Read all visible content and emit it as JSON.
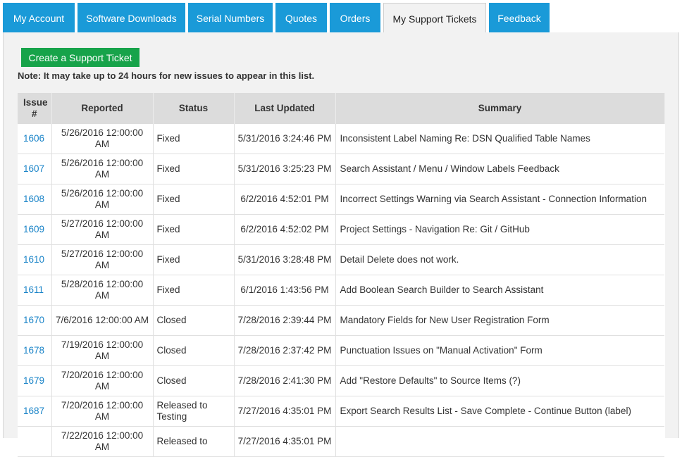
{
  "tabs": [
    {
      "label": "My Account",
      "width": 102,
      "active": false
    },
    {
      "label": "Software Downloads",
      "width": 153,
      "active": false
    },
    {
      "label": "Serial Numbers",
      "width": 120,
      "active": false
    },
    {
      "label": "Quotes",
      "width": 73,
      "active": false
    },
    {
      "label": "Orders",
      "width": 72,
      "active": false
    },
    {
      "label": "My Support Tickets",
      "width": 146,
      "active": true
    },
    {
      "label": "Feedback",
      "width": 86,
      "active": false
    }
  ],
  "create_button": "Create a Support Ticket",
  "note": "Note: It may take up to 24 hours for new issues to appear in this list.",
  "table": {
    "headers": {
      "issue": "Issue #",
      "reported": "Reported",
      "status": "Status",
      "updated": "Last Updated",
      "summary": "Summary"
    },
    "rows": [
      {
        "issue": "1606",
        "reported": "5/26/2016 12:00:00 AM",
        "status": "Fixed",
        "updated": "5/31/2016 3:24:46 PM",
        "summary": "Inconsistent Label Naming Re: DSN Qualified Table Names"
      },
      {
        "issue": "1607",
        "reported": "5/26/2016 12:00:00 AM",
        "status": "Fixed",
        "updated": "5/31/2016 3:25:23 PM",
        "summary": "Search Assistant / Menu / Window Labels Feedback"
      },
      {
        "issue": "1608",
        "reported": "5/26/2016 12:00:00 AM",
        "status": "Fixed",
        "updated": "6/2/2016 4:52:01 PM",
        "summary": "Incorrect Settings Warning via Search Assistant - Connection Information"
      },
      {
        "issue": "1609",
        "reported": "5/27/2016 12:00:00 AM",
        "status": "Fixed",
        "updated": "6/2/2016 4:52:02 PM",
        "summary": "Project Settings - Navigation Re: Git / GitHub"
      },
      {
        "issue": "1610",
        "reported": "5/27/2016 12:00:00 AM",
        "status": "Fixed",
        "updated": "5/31/2016 3:28:48 PM",
        "summary": "Detail Delete does not work."
      },
      {
        "issue": "1611",
        "reported": "5/28/2016 12:00:00 AM",
        "status": "Fixed",
        "updated": "6/1/2016 1:43:56 PM",
        "summary": "Add Boolean Search Builder to Search Assistant"
      },
      {
        "issue": "1670",
        "reported": "7/6/2016 12:00:00 AM",
        "status": "Closed",
        "updated": "7/28/2016 2:39:44 PM",
        "summary": "Mandatory Fields for New User Registration Form"
      },
      {
        "issue": "1678",
        "reported": "7/19/2016 12:00:00 AM",
        "status": "Closed",
        "updated": "7/28/2016 2:37:42 PM",
        "summary": "Punctuation Issues on \"Manual Activation\" Form"
      },
      {
        "issue": "1679",
        "reported": "7/20/2016 12:00:00 AM",
        "status": "Closed",
        "updated": "7/28/2016 2:41:30 PM",
        "summary": "Add \"Restore Defaults\" to Source Items (?)"
      },
      {
        "issue": "1687",
        "reported": "7/20/2016 12:00:00 AM",
        "status": "Released to Testing",
        "updated": "7/27/2016 4:35:01 PM",
        "summary": "Export Search Results List - Save Complete - Continue Button (label)"
      },
      {
        "issue": "",
        "reported": "7/22/2016 12:00:00 AM",
        "status": "Released to",
        "updated": "7/27/2016 4:35:01 PM",
        "summary": ""
      }
    ]
  }
}
